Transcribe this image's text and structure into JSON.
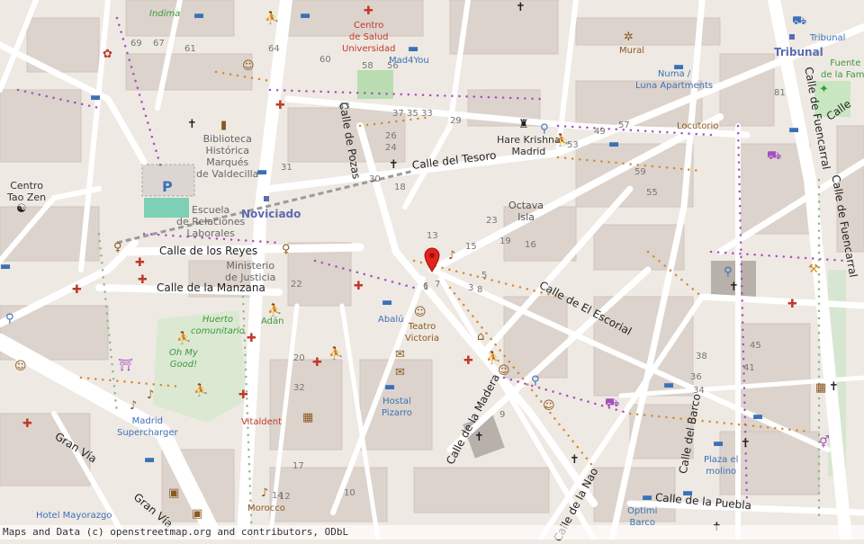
{
  "streets": {
    "tesoro": "Calle del Tesoro",
    "reyes": "Calle de los Reyes",
    "manzana": "Calle de la Manzana",
    "pozas": "Calle de Pozas",
    "escorial": "Calle de El Escorial",
    "madera": "Calle de la Madera",
    "barco": "Calle del Barco",
    "puebla": "Calle de la Puebla",
    "gran_via_1": "Gran Vía",
    "gran_via_2": "Gran Vía",
    "fuencarral_1": "Calle de Fuencarral",
    "fuencarral_2": "Calle de Fuencarral",
    "nao": "Calle de la Nao",
    "calle_right": "Calle"
  },
  "districts": {
    "noviciado": "Noviciado",
    "tribunal_metro": "Tribunal"
  },
  "pois": {
    "indima": "Indima",
    "centro_salud_1": "Centro",
    "centro_salud_2": "de Salud",
    "centro_salud_3": "Universidad",
    "mad4you": "Mad4You",
    "mural": "Mural",
    "tribunal": "Tribunal",
    "fuente_1": "Fuente",
    "fuente_2": "de la Fama",
    "numa_1": "Numa /",
    "numa_2": "Luna Apartments",
    "biblioteca_1": "Biblioteca",
    "biblioteca_2": "Histórica",
    "biblioteca_3": "Marqués",
    "biblioteca_4": "de Valdecilla",
    "hare_1": "Hare Krishna",
    "hare_2": "Madrid",
    "locutorio": "Locutorio",
    "centro_tao_1": "Centro",
    "centro_tao_2": "Tao Zen",
    "escuela_1": "Escuela",
    "escuela_2": "de Relaciones",
    "escuela_3": "Laborales",
    "octava_1": "Octava",
    "octava_2": "Isla",
    "ministerio_1": "Ministerio",
    "ministerio_2": "de Justicia",
    "adan": "Adán",
    "huerto_1": "Huerto",
    "huerto_2": "comunitario",
    "abalu": "Abalú",
    "teatro_1": "Teatro",
    "teatro_2": "Victoria",
    "ohmygood_1": "Oh My",
    "ohmygood_2": "Good!",
    "hostal_1": "Hostal",
    "hostal_2": "Pizarro",
    "madrid_sc_1": "Madrid",
    "madrid_sc_2": "Supercharger",
    "vitaldent": "Vitaldent",
    "plaza_molino_1": "Plaza el",
    "plaza_molino_2": "molino",
    "hotel_mayorazgo": "Hotel Mayorazgo",
    "morocco": "Morocco",
    "optimi_1": "Optimi",
    "optimi_2": "Barco"
  },
  "house_numbers": [
    "69",
    "67",
    "61",
    "64",
    "60",
    "58",
    "56",
    "43",
    "37",
    "35",
    "33",
    "29",
    "26",
    "24",
    "31",
    "30",
    "18",
    "13",
    "23",
    "19",
    "15",
    "16",
    "6",
    "5",
    "3",
    "8",
    "7",
    "1",
    "22",
    "20",
    "32",
    "14",
    "12",
    "17",
    "10",
    "9",
    "38",
    "45",
    "41",
    "36",
    "34",
    "81",
    "59",
    "53",
    "49",
    "57",
    "55"
  ],
  "attribution": "Maps and Data (c) openstreetmap.org and contributors, ODbL",
  "colors": {
    "background": "#efe9e3",
    "street": "#ffffff",
    "pedestrian": "#dcd6d2",
    "building": "#d9d0c9",
    "park": "#c8e6c0",
    "marker": "#e1251b",
    "poi_blue": "#3a71b8",
    "poi_red": "#c0392b"
  }
}
